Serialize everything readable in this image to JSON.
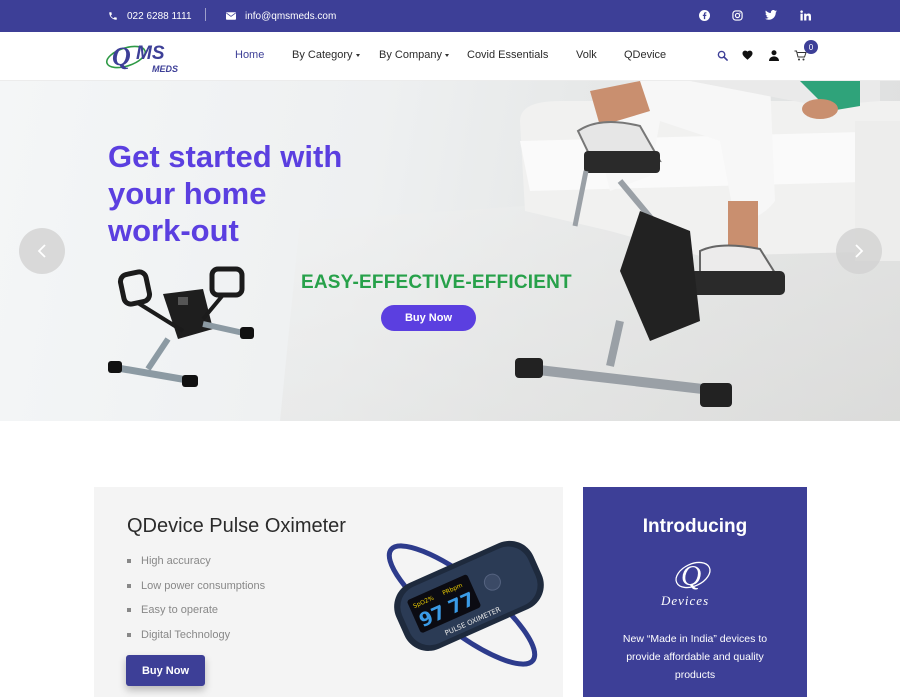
{
  "topbar": {
    "phone": "022 6288 1111",
    "email": "info@qmsmeds.com",
    "social": [
      "facebook-icon",
      "instagram-icon",
      "twitter-icon",
      "linkedin-icon"
    ]
  },
  "header": {
    "logo_text": "QMS",
    "logo_sub": "MEDS",
    "nav": [
      {
        "label": "Home",
        "active": true
      },
      {
        "label": "By Category",
        "dropdown": true
      },
      {
        "label": "By Company",
        "dropdown": true
      },
      {
        "label": "Covid Essentials"
      },
      {
        "label": "Volk"
      },
      {
        "label": "QDevice"
      }
    ],
    "icons": [
      "search-icon",
      "heart-icon",
      "user-icon",
      "cart-icon"
    ],
    "cart_count": "0"
  },
  "hero": {
    "title_lines": [
      "Get started with",
      "your home",
      "work-out"
    ],
    "tagline": "EASY-EFFECTIVE-EFFICIENT",
    "button": "Buy Now"
  },
  "oximeter": {
    "title": "QDevice Pulse Oximeter",
    "features": [
      "High accuracy",
      "Low power consumptions",
      "Easy to operate",
      "Digital Technology"
    ],
    "button": "Buy Now",
    "device_label": "PULSE OXIMETER",
    "readout_spo2": "97",
    "readout_pr": "77"
  },
  "intro": {
    "title": "Introducing",
    "logo_text": "Devices",
    "text": "New “Made in India” devices to provide affordable and quality products"
  },
  "colors": {
    "brand": "#3d3f97",
    "hero_purple": "#5b3fe0",
    "tagline_green": "#27a14a"
  }
}
